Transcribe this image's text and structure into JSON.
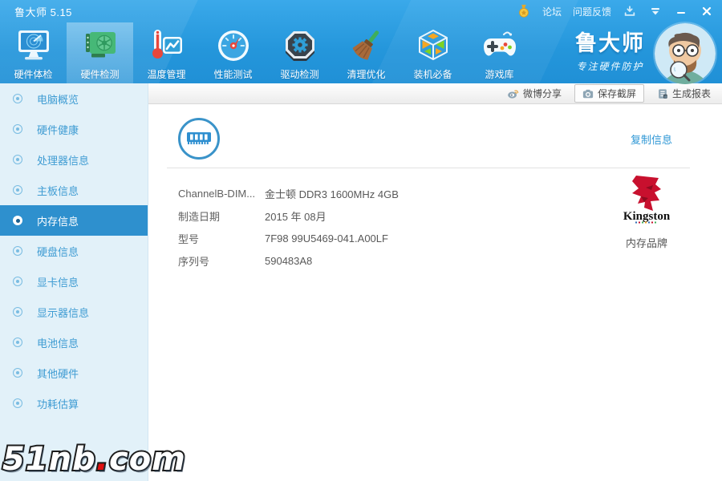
{
  "app": {
    "title": "鲁大师 5.15"
  },
  "titlebar": {
    "forum": "论坛",
    "feedback": "问题反馈",
    "icons": [
      "medal-icon",
      "download-icon",
      "skin-icon",
      "minimize-icon",
      "close-icon"
    ]
  },
  "toolbar": {
    "items": [
      {
        "label": "硬件体检",
        "icon": "monitor-checkup-icon",
        "active": false
      },
      {
        "label": "硬件检测",
        "icon": "gpu-card-icon",
        "active": true
      },
      {
        "label": "温度管理",
        "icon": "thermometer-chart-icon",
        "active": false
      },
      {
        "label": "性能测试",
        "icon": "speed-gauge-icon",
        "active": false
      },
      {
        "label": "驱动检测",
        "icon": "gear-octagon-icon",
        "active": false
      },
      {
        "label": "清理优化",
        "icon": "broom-icon",
        "active": false
      },
      {
        "label": "装机必备",
        "icon": "cube-icon",
        "active": false
      },
      {
        "label": "游戏库",
        "icon": "gamepad-icon",
        "active": false
      }
    ],
    "brand": {
      "name": "鲁大师",
      "slogan": "专注硬件防护"
    }
  },
  "actionbar": {
    "weibo_share": "微博分享",
    "save_screenshot": "保存截屏",
    "generate_report": "生成报表"
  },
  "sidebar": {
    "items": [
      {
        "label": "电脑概览",
        "active": false
      },
      {
        "label": "硬件健康",
        "active": false
      },
      {
        "label": "处理器信息",
        "active": false
      },
      {
        "label": "主板信息",
        "active": false
      },
      {
        "label": "内存信息",
        "active": true
      },
      {
        "label": "硬盘信息",
        "active": false
      },
      {
        "label": "显卡信息",
        "active": false
      },
      {
        "label": "显示器信息",
        "active": false
      },
      {
        "label": "电池信息",
        "active": false
      },
      {
        "label": "其他硬件",
        "active": false
      },
      {
        "label": "功耗估算",
        "active": false
      }
    ]
  },
  "content": {
    "copy_info": "复制信息",
    "rows": [
      {
        "label": "ChannelB-DIM...",
        "value": "金士顿 DDR3 1600MHz 4GB"
      },
      {
        "label": "制造日期",
        "value": "2015 年 08月"
      },
      {
        "label": "型号",
        "value": "7F98 99U5469-041.A00LF"
      },
      {
        "label": "序列号",
        "value": "590483A8"
      }
    ],
    "brand_card": {
      "brand": "Kingston",
      "caption": "内存品牌"
    }
  },
  "watermark": {
    "pre": "51nb",
    "dot": ".",
    "post": "com"
  },
  "colors": {
    "titlebar_blue": "#2496db",
    "accent_blue": "#2e97d5",
    "sidebar_bg": "#e2f1f9",
    "sidebar_selected": "#2e90ce",
    "toolbar_active_highlight": "rgba(255,255,255,0.30)",
    "kingston_red": "#c8102e"
  }
}
